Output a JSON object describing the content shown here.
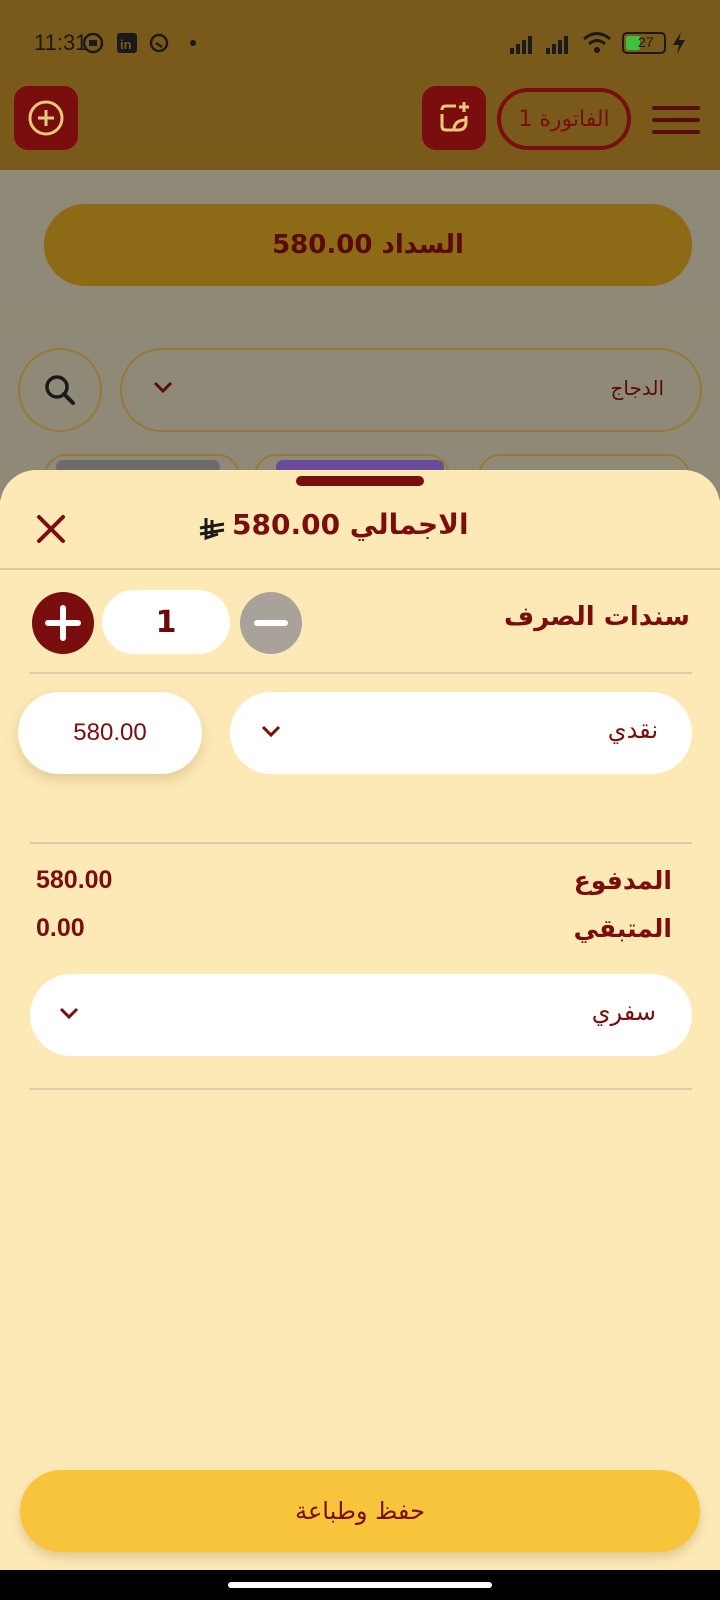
{
  "status_bar": {
    "time": "11:31",
    "battery": "27"
  },
  "app_bar": {
    "invoice_label": "الفاتورة 1"
  },
  "background": {
    "pay_label": "السداد 580.00",
    "category_selected": "الدجاج"
  },
  "sheet": {
    "title": "الاجمالي 580.00",
    "vouchers_label": "سندات الصرف",
    "quantity": "1",
    "payment_method": "نقدي",
    "payment_amount": "580.00",
    "paid_label": "المدفوع",
    "paid_value": "580.00",
    "remaining_label": "المتبقي",
    "remaining_value": "0.00",
    "order_type": "سفري",
    "save_button": "حفظ وطباعة"
  },
  "colors": {
    "primary": "#7A0E0E",
    "accent": "#F8C43C",
    "sheet_bg": "#FDE9B6",
    "appbar": "#7A5A1B"
  },
  "icons": [
    "plus-icon",
    "edit-sticker-icon",
    "menu-icon",
    "search-icon",
    "chevron-down-icon",
    "close-icon",
    "riyal-icon",
    "minus-icon"
  ]
}
